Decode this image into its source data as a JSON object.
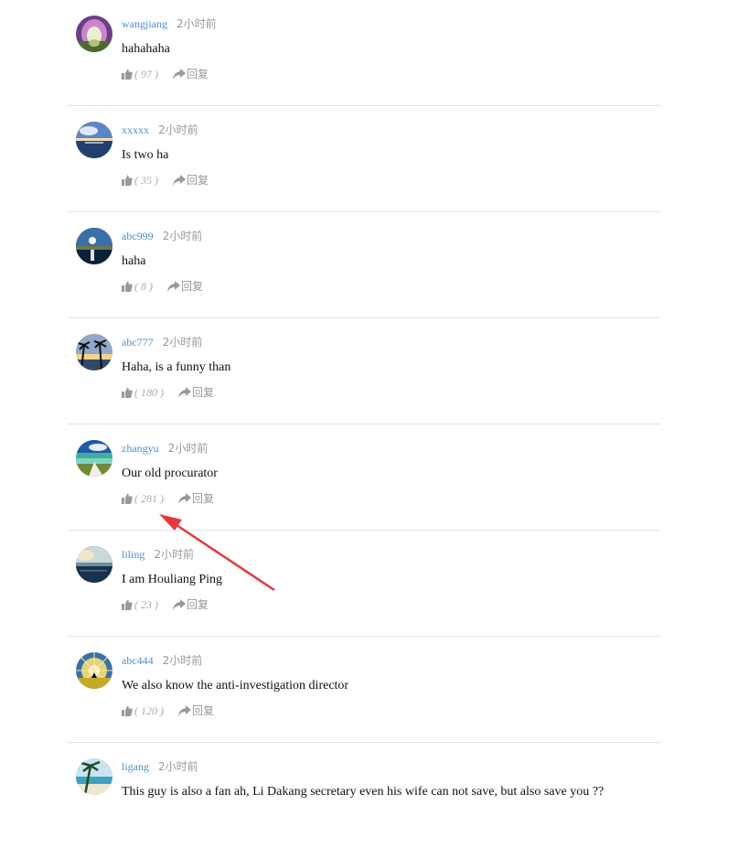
{
  "comments": [
    {
      "user": "wangjiang",
      "time": "2小时前",
      "text": "hahahaha",
      "likes": "97",
      "reply": "回复",
      "avatar": "purple-flower-tunnel"
    },
    {
      "user": "xxxxx",
      "time": "2小时前",
      "text": "Is two ha",
      "likes": "35",
      "reply": "回复",
      "avatar": "sea-sunset"
    },
    {
      "user": "abc999",
      "time": "2小时前",
      "text": "haha",
      "likes": "8",
      "reply": "回复",
      "avatar": "moon-over-lake"
    },
    {
      "user": "abc777",
      "time": "2小时前",
      "text": "Haha, is a funny than",
      "likes": "180",
      "reply": "回复",
      "avatar": "palm-sunset"
    },
    {
      "user": "zhangyu",
      "time": "2小时前",
      "text": "Our old procurator",
      "likes": "281",
      "reply": "回复",
      "avatar": "beach-shore"
    },
    {
      "user": "liling",
      "time": "2小时前",
      "text": "I am Houliang Ping",
      "likes": "23",
      "reply": "回复",
      "avatar": "ocean-horizon"
    },
    {
      "user": "abc444",
      "time": "2小时前",
      "text": "We also know the anti-investigation director",
      "likes": "120",
      "reply": "回复",
      "avatar": "sunburst-field"
    },
    {
      "user": "ligang",
      "time": "2小时前",
      "text": "This guy is also a fan ah, Li Dakang secretary even his wife can not save, but also save you ??",
      "likes": "",
      "reply": "",
      "avatar": "tropical-beach"
    }
  ],
  "colors": {
    "username": "#4a8fd1",
    "muted": "#999999",
    "annotation_arrow": "#e8373a"
  }
}
